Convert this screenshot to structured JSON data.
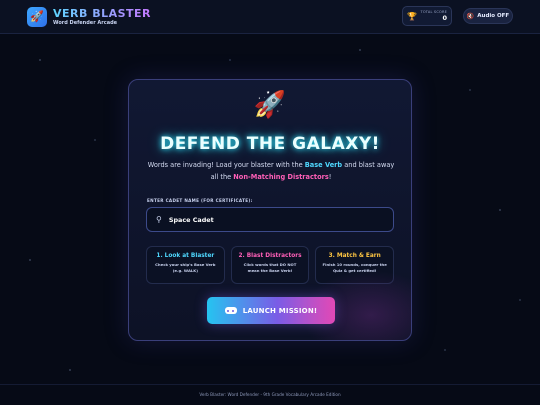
{
  "header": {
    "logo_icon": "rocket-icon",
    "title": "VERB BLASTER",
    "subtitle": "Word Defender Arcade",
    "score_label": "TOTAL SCORE",
    "score_value": "0",
    "trophy_icon": "trophy-icon",
    "audio_label": "Audio OFF",
    "audio_icon": "speaker-icon"
  },
  "hero": {
    "emoji": "🚀",
    "headline": "DEFEND THE GALAXY!",
    "line_part1": "Words are invading! Load your blaster with the ",
    "line_highlight1": "Base Verb",
    "line_part2": " and blast away all the ",
    "line_highlight2": "Non-Matching Distractors",
    "line_part3": "!"
  },
  "form": {
    "label": "ENTER CADET NAME (FOR CERTIFICATE):",
    "name_value": "Space Cadet"
  },
  "steps": [
    {
      "title": "1. Look at Blaster",
      "desc": "Check your ship's Base Verb (e.g. WALK)"
    },
    {
      "title": "2. Blast Distractors",
      "desc": "Click words that DO NOT mean the Base Verb!"
    },
    {
      "title": "3. Match & Earn",
      "desc": "Finish 10 rounds, conquer the Quiz & get certified!"
    }
  ],
  "launch_label": "LAUNCH MISSION!",
  "footer": "Verb Blaster: Word Defender - 9th Grade Vocabulary Arcade Edition",
  "colors": {
    "accent_cyan": "#4fd8ff",
    "accent_pink": "#ff5fb7",
    "accent_gold": "#ffc642",
    "background": "#060a16"
  }
}
